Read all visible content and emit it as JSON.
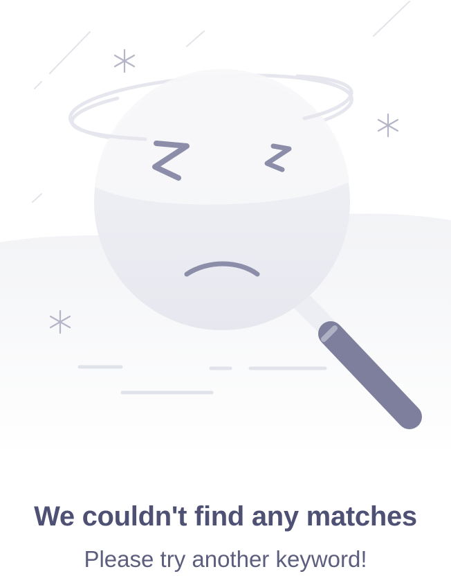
{
  "empty_state": {
    "title": "We couldn't find any matches",
    "subtitle": "Please try another keyword!",
    "illustration_icon": "sleepy-magnifying-glass-icon"
  },
  "colors": {
    "title": "#4f5174",
    "subtitle": "#5c5e7e",
    "handle": "#7e7f9c",
    "lens": "#e9eaf1",
    "sparkle": "#b4b6c8",
    "background_wave": "#f3f4f7"
  }
}
